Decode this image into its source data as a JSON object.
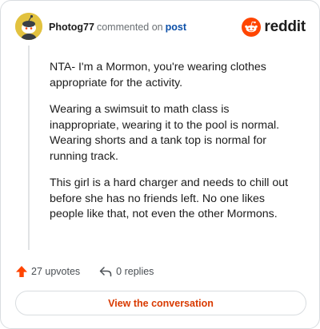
{
  "header": {
    "username": "Photog77",
    "commented_text": "commented on",
    "post_link": "post",
    "brand_name": "reddit",
    "brand_color": "#ff4500"
  },
  "comment": {
    "paragraphs": [
      "NTA- I'm a Mormon, you're wearing clothes appropriate for the activity.",
      "Wearing a swimsuit to math class is inappropriate, wearing it to the pool is normal. Wearing shorts and a tank top is normal for running track.",
      "This girl is a hard charger and needs to chill out before she has no friends left. No one likes people like that, not even the other Mormons."
    ]
  },
  "actions": {
    "upvotes": "27 upvotes",
    "upvote_icon": "upvote-arrow-icon",
    "upvote_color": "#ff4500",
    "replies": "0 replies",
    "reply_icon": "reply-arrow-icon"
  },
  "button": {
    "label": "View the conversation",
    "color": "#d93a00"
  }
}
